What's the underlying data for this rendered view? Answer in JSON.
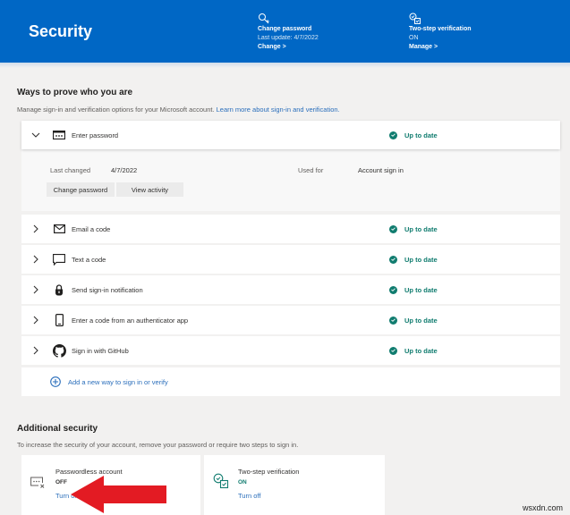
{
  "banner": {
    "title": "Security",
    "change_password": {
      "icon": "key-icon",
      "title": "Change password",
      "subtitle": "Last update: 4/7/2022",
      "link": "Change >"
    },
    "two_step": {
      "icon": "two-step-verification-icon",
      "title": "Two-step verification",
      "subtitle": "ON",
      "link": "Manage >"
    }
  },
  "ways": {
    "title": "Ways to prove who you are",
    "description": "Manage sign-in and verification options for your Microsoft account.",
    "learn_more": "Learn more about sign-in and verification.",
    "methods": [
      {
        "icon": "password-icon",
        "label": "Enter password",
        "status": "Up to date",
        "expanded": true
      },
      {
        "icon": "email-icon",
        "label": "Email a code",
        "status": "Up to date"
      },
      {
        "icon": "chat-icon",
        "label": "Text a code",
        "status": "Up to date"
      },
      {
        "icon": "lock-icon",
        "label": "Send sign-in notification",
        "status": "Up to date"
      },
      {
        "icon": "phone-icon",
        "label": "Enter a code from an authenticator app",
        "status": "Up to date"
      },
      {
        "icon": "github-icon",
        "label": "Sign in with GitHub",
        "status": "Up to date"
      }
    ],
    "password_detail": {
      "last_changed_label": "Last changed",
      "last_changed_value": "4/7/2022",
      "used_for_label": "Used for",
      "used_for_value": "Account sign in",
      "change_password_button": "Change password",
      "view_activity_button": "View activity"
    },
    "add_new": "Add a new way to sign in or verify"
  },
  "additional": {
    "title": "Additional security",
    "description": "To increase the security of your account, remove your password or require two steps to sign in.",
    "cards": [
      {
        "icon": "passwordless-icon",
        "title": "Passwordless account",
        "state": "OFF",
        "link": "Turn on"
      },
      {
        "icon": "two-step-verification-icon",
        "title": "Two-step verification",
        "state": "ON",
        "link": "Turn off"
      }
    ]
  },
  "colors": {
    "brand": "#0067c5",
    "status_green": "#107c6f",
    "link": "#2a6ebb",
    "arrow": "#e31b23"
  },
  "watermark": "wsxdn.com"
}
